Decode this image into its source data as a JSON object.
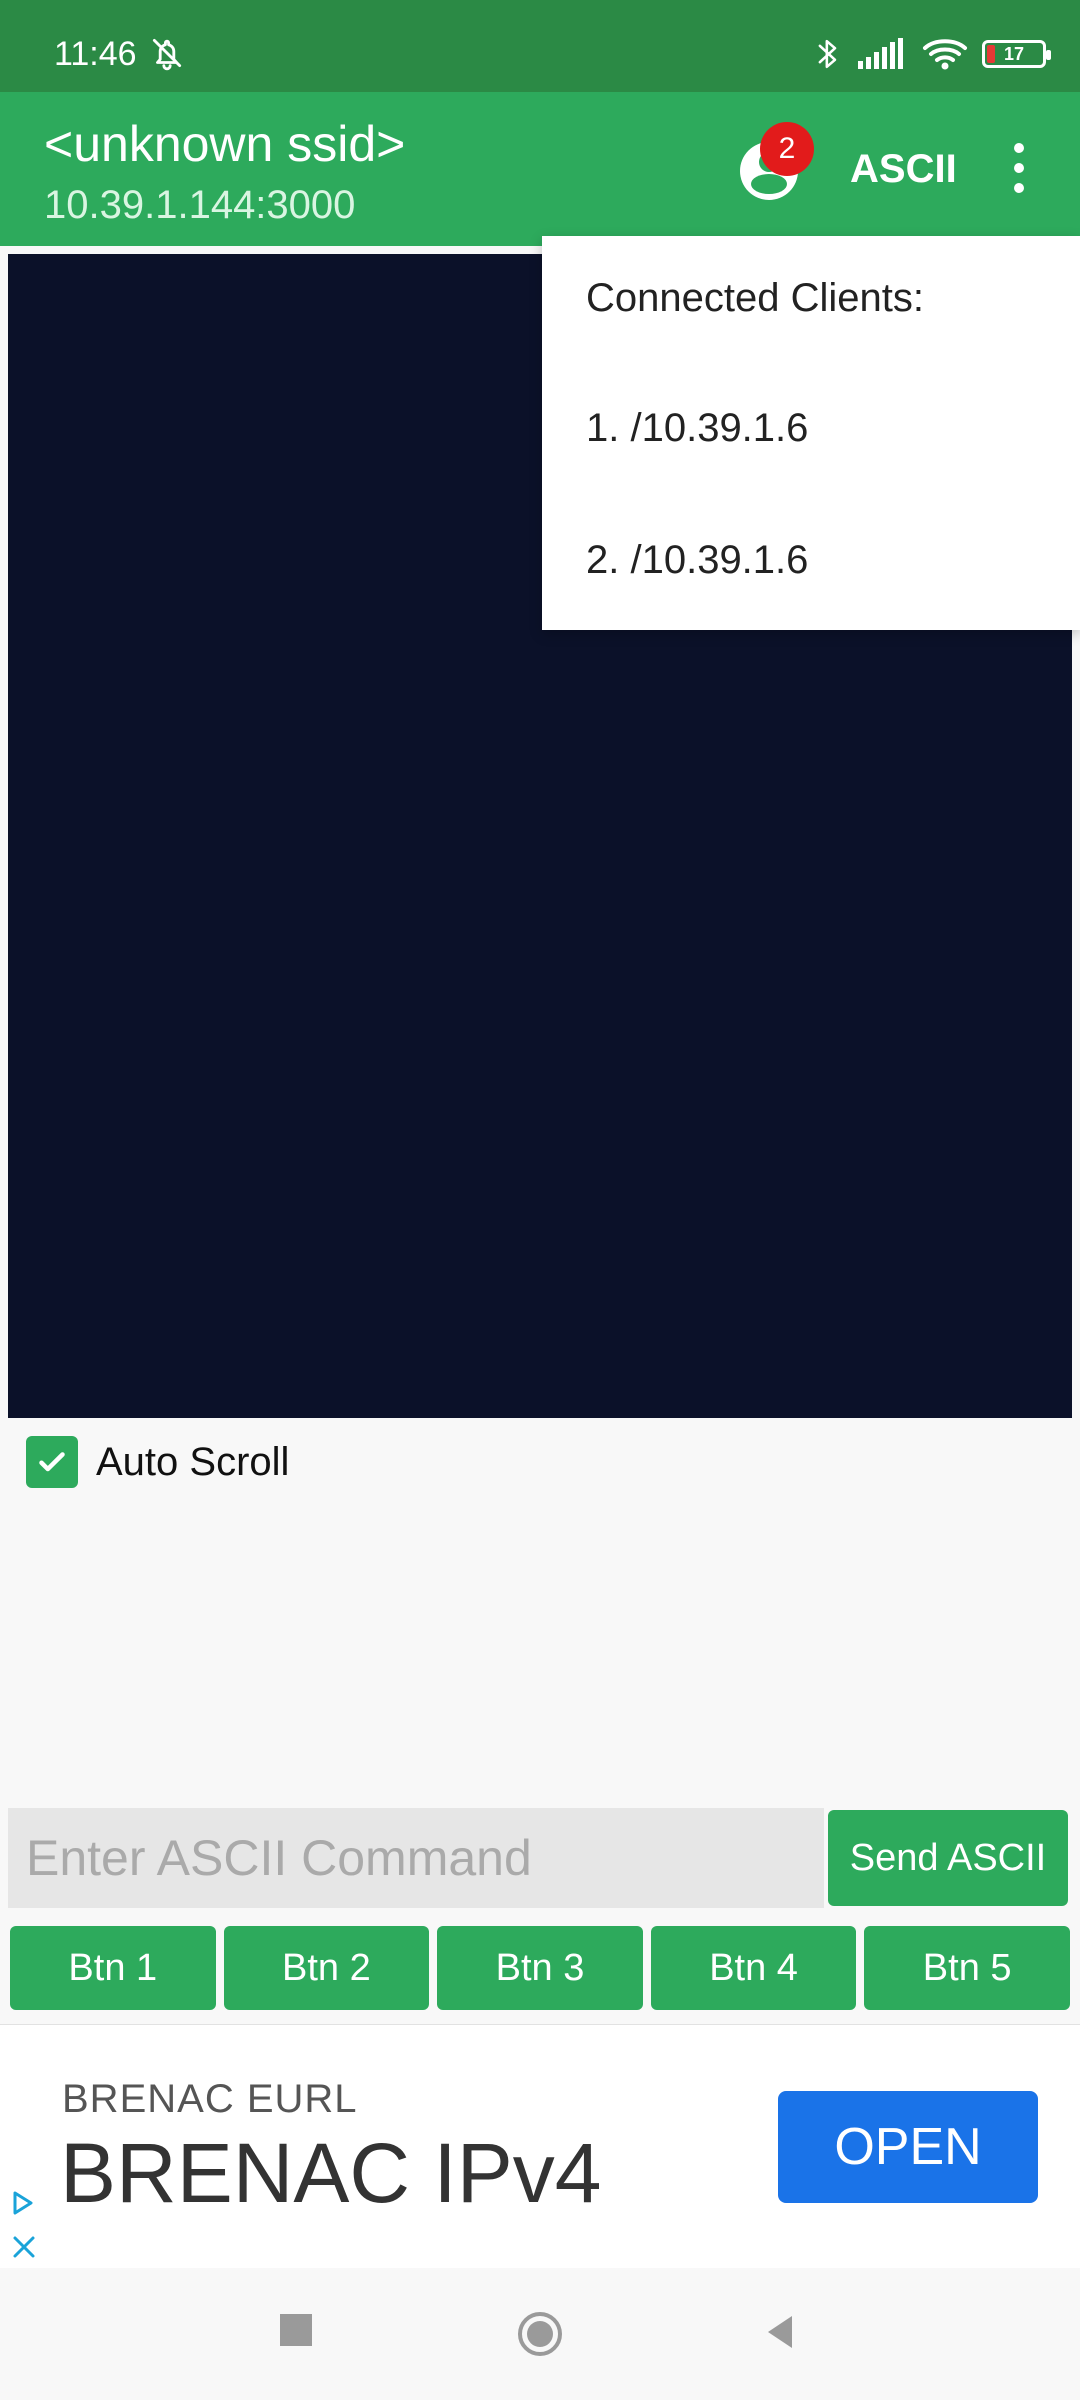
{
  "status_bar": {
    "time": "11:46",
    "battery": "17"
  },
  "app_bar": {
    "title": "<unknown ssid>",
    "subtitle": "10.39.1.144:3000",
    "client_count": "2",
    "mode": "ASCII"
  },
  "dropdown": {
    "title": "Connected Clients:",
    "items": [
      "1. /10.39.1.6",
      "2. /10.39.1.6"
    ]
  },
  "autoscroll": {
    "label": "Auto Scroll",
    "checked": true
  },
  "command": {
    "placeholder": "Enter ASCII Command",
    "send_label": "Send ASCII"
  },
  "buttons": [
    "Btn 1",
    "Btn 2",
    "Btn 3",
    "Btn 4",
    "Btn 5"
  ],
  "ad": {
    "company": "BRENAC EURL",
    "title": "BRENAC IPv4",
    "cta": "OPEN"
  },
  "colors": {
    "status_bar": "#2b8a45",
    "app_bar": "#2daa5c",
    "terminal": "#0b1129",
    "badge": "#e21b1b",
    "ad_button": "#1a73e8"
  }
}
